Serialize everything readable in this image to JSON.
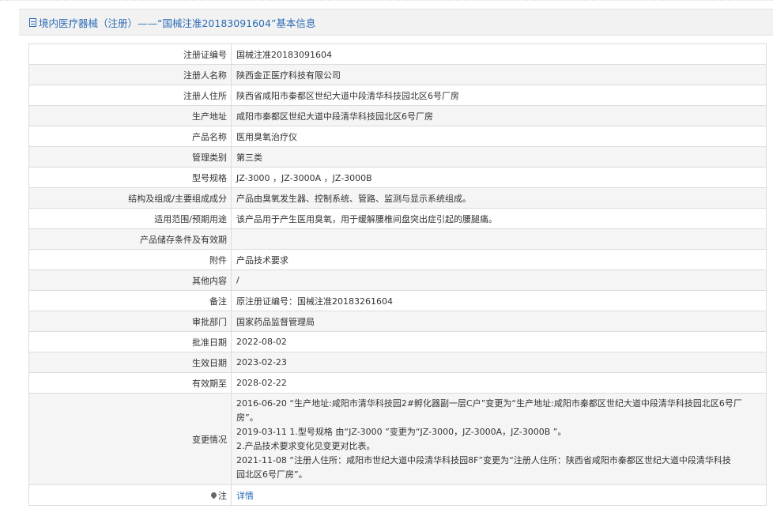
{
  "title": {
    "text": "境内医疗器械（注册）——“国械注准20183091604”基本信息",
    "icon": "document-icon"
  },
  "rows": [
    {
      "label": "注册证编号",
      "value": "国械注准20183091604"
    },
    {
      "label": "注册人名称",
      "value": "陕西金正医疗科技有限公司"
    },
    {
      "label": "注册人住所",
      "value": "陕西省咸阳市秦都区世纪大道中段清华科技园北区6号厂房"
    },
    {
      "label": "生产地址",
      "value": "咸阳市秦都区世纪大道中段清华科技园北区6号厂房"
    },
    {
      "label": "产品名称",
      "value": "医用臭氧治疗仪"
    },
    {
      "label": "管理类别",
      "value": "第三类"
    },
    {
      "label": "型号规格",
      "value": "JZ-3000 ，JZ-3000A ，JZ-3000B"
    },
    {
      "label": "结构及组成/主要组成成分",
      "value": "产品由臭氧发生器、控制系统、管路、监测与显示系统组成。"
    },
    {
      "label": "适用范围/预期用途",
      "value": "该产品用于产生医用臭氧，用于缓解腰椎间盘突出症引起的腰腿痛。"
    },
    {
      "label": "产品储存条件及有效期",
      "value": ""
    },
    {
      "label": "附件",
      "value": "产品技术要求"
    },
    {
      "label": "其他内容",
      "value": "/"
    },
    {
      "label": "备注",
      "value": "原注册证编号：国械注准20183261604"
    },
    {
      "label": "审批部门",
      "value": "国家药品监督管理局"
    },
    {
      "label": "批准日期",
      "value": "2022-08-02"
    },
    {
      "label": "生效日期",
      "value": "2023-02-23"
    },
    {
      "label": "有效期至",
      "value": "2028-02-22"
    }
  ],
  "change": {
    "label": "变更情况",
    "lines": [
      "2016-06-20 “生产地址:咸阳市清华科技园2#孵化器副一层C户”变更为“生产地址:咸阳市秦都区世纪大道中段清华科技园北区6号厂",
      "房”。",
      "2019-03-11 1.型号规格 由“JZ-3000 ”变更为“JZ-3000，JZ-3000A，JZ-3000B ”。",
      "2.产品技术要求变化见变更对比表。",
      "2021-11-08 “注册人住所：咸阳市世纪大道中段清华科技园8F”变更为“注册人住所：陕西省咸阳市秦都区世纪大道中段清华科技",
      "园北区6号厂房”。"
    ]
  },
  "note": {
    "label": "注",
    "link_text": "详情",
    "icon": "pin-icon"
  }
}
